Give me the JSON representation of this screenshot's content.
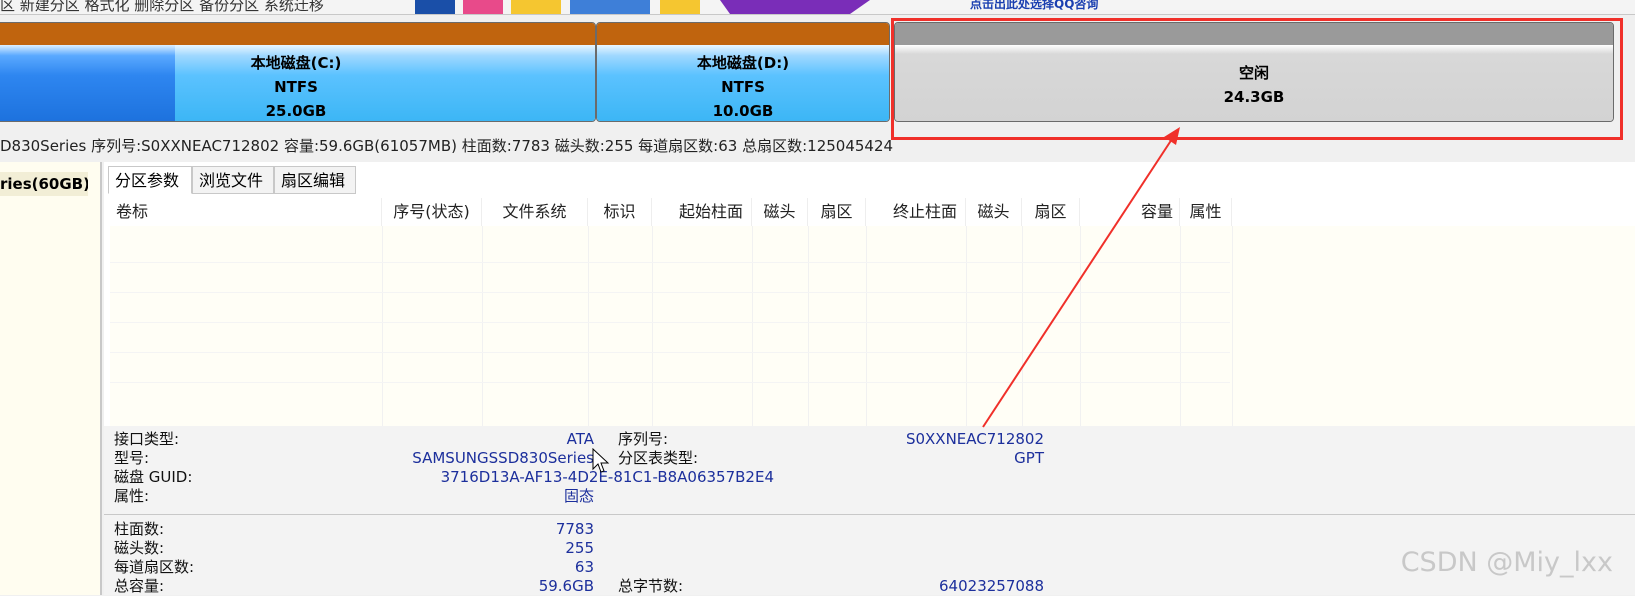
{
  "toolbar": {
    "menu_text": "区 新建分区 格式化 删除分区 备份分区 系统迁移",
    "ad_text": "点击出此处选择QQ咨询"
  },
  "partitions": [
    {
      "name": "本地磁盘(C:)",
      "fs": "NTFS",
      "size": "25.0GB"
    },
    {
      "name": "本地磁盘(D:)",
      "fs": "NTFS",
      "size": "10.0GB"
    },
    {
      "name": "空闲",
      "size": "24.3GB"
    }
  ],
  "disk_line": "D830Series  序列号:S0XXNEAC712802  容量:59.6GB(61057MB)  柱面数:7783  磁头数:255  每道扇区数:63  总扇区数:125045424",
  "tree": {
    "item": "ries(60GB)"
  },
  "tabs": [
    {
      "label": "分区参数",
      "active": true
    },
    {
      "label": "浏览文件",
      "active": false
    },
    {
      "label": "扇区编辑",
      "active": false
    }
  ],
  "columns": [
    "卷标",
    "序号(状态)",
    "文件系统",
    "标识",
    "起始柱面",
    "磁头",
    "扇区",
    "终止柱面",
    "磁头",
    "扇区",
    "容量",
    "属性"
  ],
  "details": {
    "interface_label": "接口类型:",
    "interface_value": "ATA",
    "serial_label": "序列号:",
    "serial_value": "S0XXNEAC712802",
    "model_label": "型号:",
    "model_value": "SAMSUNGSSD830Series",
    "pt_label": "分区表类型:",
    "pt_value": "GPT",
    "guid_label": "磁盘 GUID:",
    "guid_value": "3716D13A-AF13-4D2E-81C1-B8A06357B2E4",
    "attr_label": "属性:",
    "attr_value": "固态",
    "cyl_label": "柱面数:",
    "cyl_value": "7783",
    "heads_label": "磁头数:",
    "heads_value": "255",
    "spt_label": "每道扇区数:",
    "spt_value": "63",
    "total_label": "总容量:",
    "total_value": "59.6GB",
    "bytes_label": "总字节数:",
    "bytes_value": "64023257088"
  },
  "watermark": "CSDN @Miy_lxx",
  "colors": {
    "highlight": "#f0302a",
    "cap": "#c0640e",
    "value_text": "#1c2f9c"
  }
}
